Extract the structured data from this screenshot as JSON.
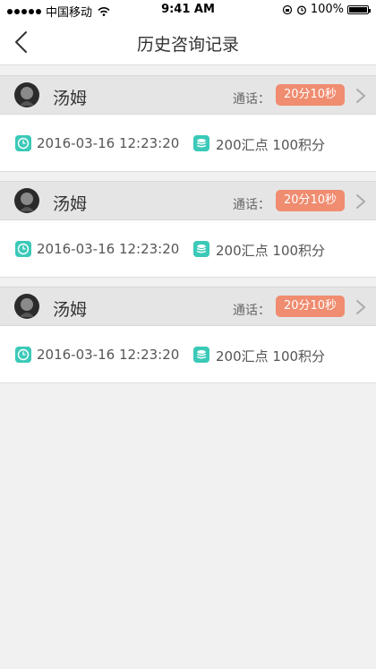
{
  "status_bar": {
    "carrier": "中国移动",
    "time": "9:41 AM",
    "battery": "100%"
  },
  "nav": {
    "title": "历史咨询记录",
    "back_icon": "chevron-left-icon"
  },
  "records": [
    {
      "name": "汤姆",
      "call_label": "通话：",
      "duration": "20分10秒",
      "datetime": "2016-03-16 12:23:20",
      "points": "200汇点 100积分"
    },
    {
      "name": "汤姆",
      "call_label": "通话：",
      "duration": "20分10秒",
      "datetime": "2016-03-16 12:23:20",
      "points": "200汇点 100积分"
    },
    {
      "name": "汤姆",
      "call_label": "通话：",
      "duration": "20分10秒",
      "datetime": "2016-03-16 12:23:20",
      "points": "200汇点 100积分"
    }
  ],
  "colors": {
    "accent": "#f08c70",
    "teal": "#3bc9b8",
    "header_bg": "#e5e5e5",
    "page_bg": "#f0f1f0"
  }
}
